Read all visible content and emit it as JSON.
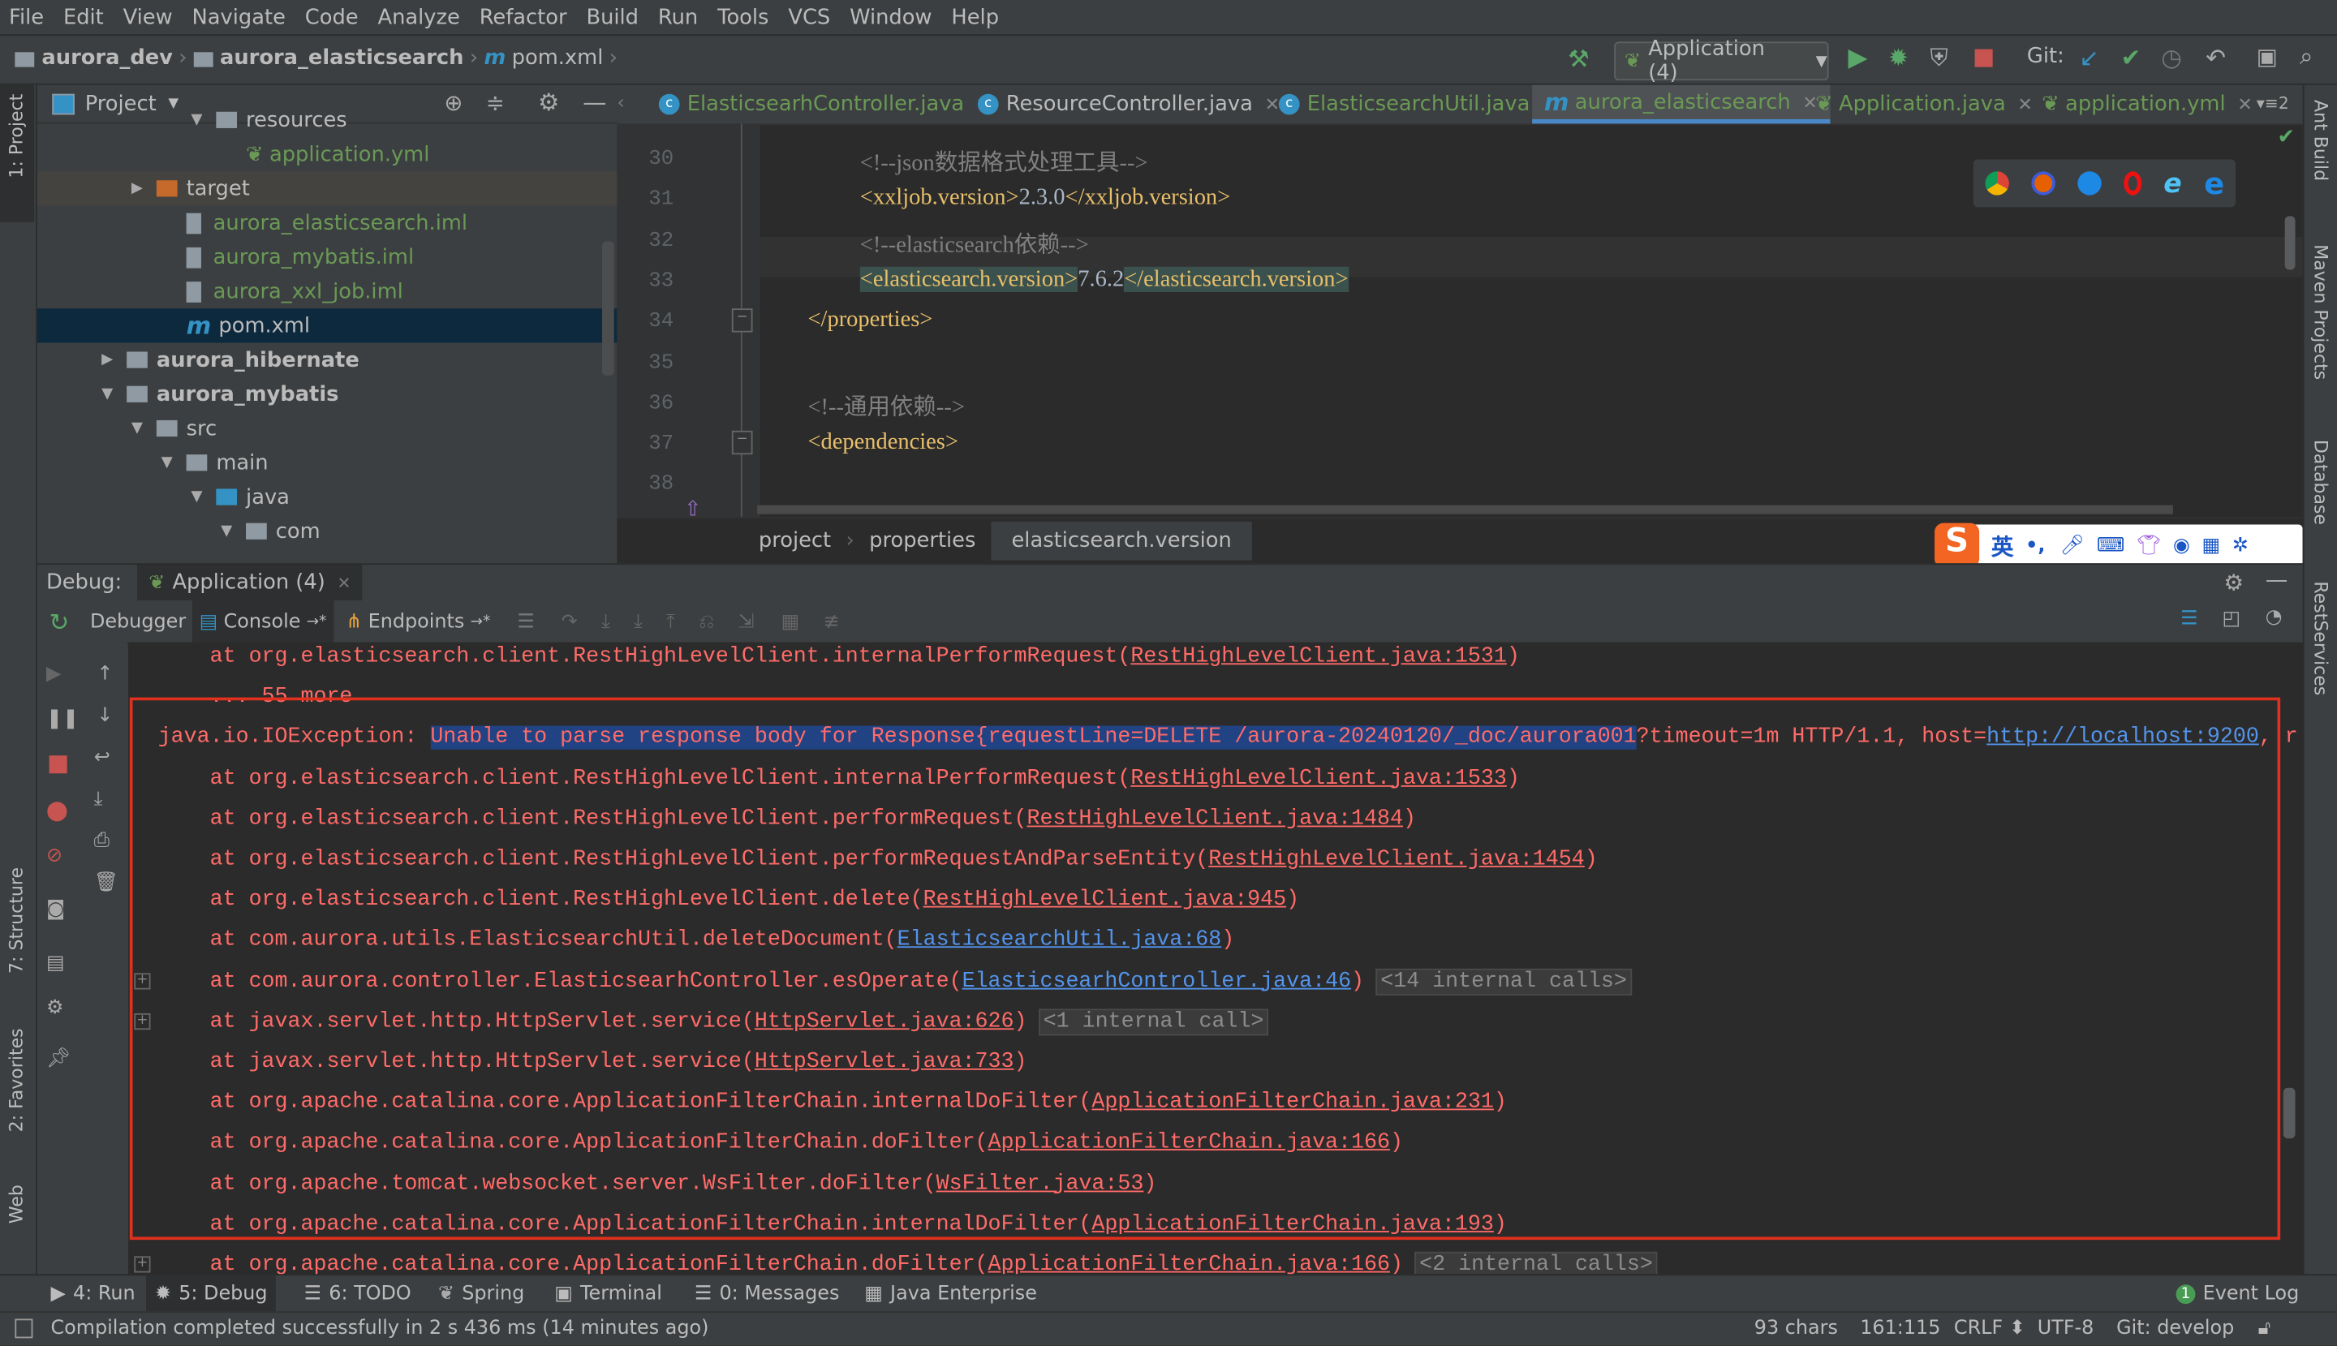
{
  "menu": [
    "File",
    "Edit",
    "View",
    "Navigate",
    "Code",
    "Analyze",
    "Refactor",
    "Build",
    "Run",
    "Tools",
    "VCS",
    "Window",
    "Help"
  ],
  "navbar": {
    "breadcrumb": [
      "aurora_dev",
      "aurora_elasticsearch",
      "pom.xml"
    ],
    "run_config": "Application (4)",
    "git_label": "Git:"
  },
  "left_strip": {
    "project": "1: Project",
    "structure": "7: Structure",
    "favorites": "2: Favorites",
    "web": "Web"
  },
  "right_strip": {
    "ant": "Ant Build",
    "maven": "Maven Projects",
    "database": "Database",
    "rest": "RestServices"
  },
  "project_panel": {
    "title": "Project",
    "tree": [
      {
        "label": "resources",
        "level": 4,
        "expanded": true,
        "type": "res-folder",
        "color": "#bbbbbb"
      },
      {
        "label": "application.yml",
        "level": 5,
        "type": "spring",
        "color": "#6a9955"
      },
      {
        "label": "target",
        "level": 2,
        "expanded": false,
        "type": "target",
        "color": "#bbbbbb"
      },
      {
        "label": "aurora_elasticsearch.iml",
        "level": 3,
        "type": "iml",
        "color": "#6a9955"
      },
      {
        "label": "aurora_mybatis.iml",
        "level": 3,
        "type": "iml",
        "color": "#6a9955"
      },
      {
        "label": "aurora_xxl_job.iml",
        "level": 3,
        "type": "iml",
        "color": "#6a9955"
      },
      {
        "label": "pom.xml",
        "level": 3,
        "type": "maven",
        "color": "#bbbbbb",
        "selected": true
      },
      {
        "label": "aurora_hibernate",
        "level": 1,
        "expanded": false,
        "type": "module",
        "color": "#bbbbbb",
        "bold": true
      },
      {
        "label": "aurora_mybatis",
        "level": 1,
        "expanded": true,
        "type": "module",
        "color": "#bbbbbb",
        "bold": true
      },
      {
        "label": "src",
        "level": 2,
        "expanded": true,
        "type": "folder",
        "color": "#bbbbbb"
      },
      {
        "label": "main",
        "level": 3,
        "expanded": true,
        "type": "folder",
        "color": "#bbbbbb"
      },
      {
        "label": "java",
        "level": 4,
        "expanded": true,
        "type": "src-folder",
        "color": "#bbbbbb"
      },
      {
        "label": "com",
        "level": 5,
        "expanded": true,
        "type": "package",
        "color": "#bbbbbb"
      }
    ]
  },
  "editor": {
    "tabs": [
      {
        "label": "ElasticsearhController.java",
        "icon": "class",
        "color": "#6a9955"
      },
      {
        "label": "ResourceController.java",
        "icon": "class",
        "color": "#bbbbbb"
      },
      {
        "label": "ElasticsearchUtil.java",
        "icon": "class",
        "color": "#6a9955"
      },
      {
        "label": "aurora_elasticsearch",
        "icon": "maven",
        "color": "#6a9955",
        "active": true
      },
      {
        "label": "Application.java",
        "icon": "spring",
        "color": "#6a9955"
      },
      {
        "label": "application.yml",
        "icon": "spring",
        "color": "#6a9955"
      }
    ],
    "more_tabs": "2",
    "lines": [
      {
        "n": "30",
        "indent": 2,
        "parts": [
          [
            "cmt",
            "<!--json数据格式处理工具-->"
          ]
        ]
      },
      {
        "n": "31",
        "indent": 2,
        "parts": [
          [
            "tag",
            "<xxljob.version>"
          ],
          [
            "txt",
            "2.3.0"
          ],
          [
            "tag",
            "</xxljob.version>"
          ]
        ]
      },
      {
        "n": "32",
        "indent": 2,
        "parts": [
          [
            "cmt",
            "<!--elasticsearch依赖-->"
          ]
        ]
      },
      {
        "n": "33",
        "indent": 2,
        "parts": [
          [
            "tag hl",
            "<elasticsearch.version>"
          ],
          [
            "txt",
            "7.6.2"
          ],
          [
            "tag hl",
            "</elasticsearch.version>"
          ]
        ],
        "current": true
      },
      {
        "n": "34",
        "indent": 1,
        "parts": [
          [
            "tag",
            "</properties>"
          ]
        ]
      },
      {
        "n": "35",
        "indent": 1,
        "parts": []
      },
      {
        "n": "36",
        "indent": 1,
        "parts": [
          [
            "cmt",
            "<!--通用依赖-->"
          ]
        ]
      },
      {
        "n": "37",
        "indent": 1,
        "parts": [
          [
            "tag",
            "<dependencies>"
          ]
        ]
      },
      {
        "n": "38",
        "indent": 1,
        "parts": []
      }
    ],
    "breadcrumb": [
      "project",
      "properties",
      "elasticsearch.version"
    ]
  },
  "ime": {
    "lang": "英",
    "punct": "•,"
  },
  "debug": {
    "label": "Debug:",
    "session": "Application (4)",
    "tabs": [
      "Debugger",
      "Console",
      "Endpoints"
    ]
  },
  "console": {
    "lines": [
      {
        "text": "    at org.elasticsearch.client.RestHighLevelClient.internalPerformRequest(",
        "link": "RestHighLevelClient.java:1531",
        "after": ")"
      },
      {
        "text": "    ... 55 more"
      },
      {
        "exception": true,
        "prefix": "java.io.IOException: ",
        "selected": "Unable to parse response body for Response{requestLine=DELETE /aurora-20240120/_doc/aurora001",
        "text": "?timeout=1m HTTP/1.1, host=",
        "url": "http://localhost:9200",
        "after": ", r"
      },
      {
        "text": "    at org.elasticsearch.client.RestHighLevelClient.internalPerformRequest(",
        "link": "RestHighLevelClient.java:1533",
        "after": ")"
      },
      {
        "text": "    at org.elasticsearch.client.RestHighLevelClient.performRequest(",
        "link": "RestHighLevelClient.java:1484",
        "after": ")"
      },
      {
        "text": "    at org.elasticsearch.client.RestHighLevelClient.performRequestAndParseEntity(",
        "link": "RestHighLevelClient.java:1454",
        "after": ")"
      },
      {
        "text": "    at org.elasticsearch.client.RestHighLevelClient.delete(",
        "link": "RestHighLevelClient.java:945",
        "after": ")"
      },
      {
        "text": "    at com.aurora.utils.ElasticsearchUtil.deleteDocument(",
        "link": "ElasticsearchUtil.java:68",
        "after": ")",
        "blue": true
      },
      {
        "text": "    at com.aurora.controller.ElasticsearhController.esOperate(",
        "link": "ElasticsearhController.java:46",
        "after": ")",
        "blue": true,
        "internal": "<14 internal calls>",
        "expander": true
      },
      {
        "text": "    at javax.servlet.http.HttpServlet.service(",
        "link": "HttpServlet.java:626",
        "after": ")",
        "internal": "<1 internal call>",
        "expander": true
      },
      {
        "text": "    at javax.servlet.http.HttpServlet.service(",
        "link": "HttpServlet.java:733",
        "after": ")"
      },
      {
        "text": "    at org.apache.catalina.core.ApplicationFilterChain.internalDoFilter(",
        "link": "ApplicationFilterChain.java:231",
        "after": ")"
      },
      {
        "text": "    at org.apache.catalina.core.ApplicationFilterChain.doFilter(",
        "link": "ApplicationFilterChain.java:166",
        "after": ")"
      },
      {
        "text": "    at org.apache.tomcat.websocket.server.WsFilter.doFilter(",
        "link": "WsFilter.java:53",
        "after": ")"
      },
      {
        "text": "    at org.apache.catalina.core.ApplicationFilterChain.internalDoFilter(",
        "link": "ApplicationFilterChain.java:193",
        "after": ")"
      },
      {
        "text": "    at org.apache.catalina.core.ApplicationFilterChain.doFilter(",
        "link": "ApplicationFilterChain.java:166",
        "after": ")",
        "internal": "<2 internal calls>",
        "expander": true
      }
    ]
  },
  "bottom_tools": [
    {
      "label": "4: Run"
    },
    {
      "label": "5: Debug",
      "active": true
    },
    {
      "label": "6: TODO"
    },
    {
      "label": "Spring"
    },
    {
      "label": "Terminal"
    },
    {
      "label": "0: Messages"
    },
    {
      "label": "Java Enterprise"
    }
  ],
  "event_log": {
    "count": "1",
    "label": "Event Log"
  },
  "status": {
    "message": "Compilation completed successfully in 2 s 436 ms (14 minutes ago)",
    "chars": "93 chars",
    "position": "161:115",
    "line_sep": "CRLF",
    "encoding": "UTF-8",
    "git": "Git: develop"
  }
}
